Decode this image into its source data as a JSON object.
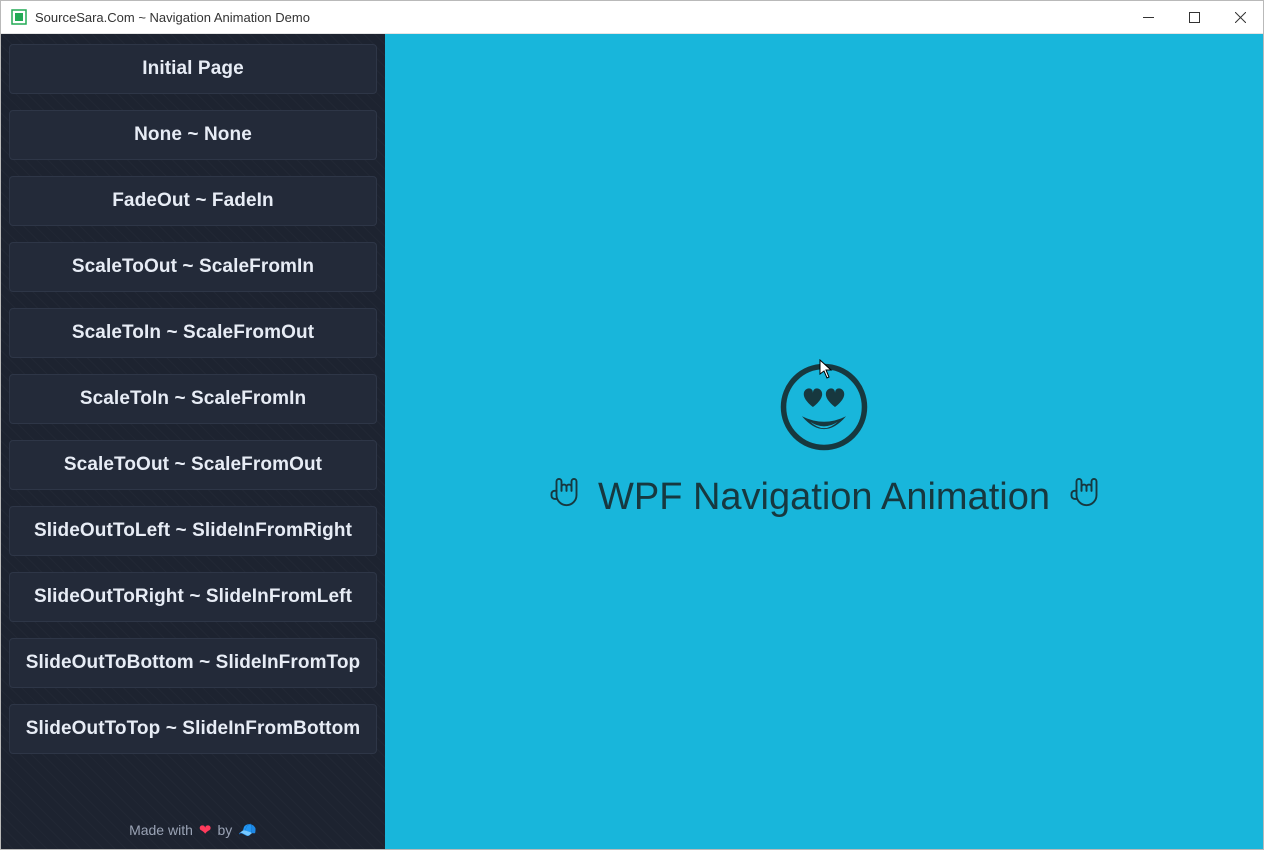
{
  "window": {
    "title": "SourceSara.Com ~ Navigation Animation Demo"
  },
  "sidebar": {
    "items": [
      {
        "label": "Initial Page"
      },
      {
        "label": "None ~ None"
      },
      {
        "label": "FadeOut ~ FadeIn"
      },
      {
        "label": "ScaleToOut ~ ScaleFromIn"
      },
      {
        "label": "ScaleToIn ~ ScaleFromOut"
      },
      {
        "label": "ScaleToIn ~ ScaleFromIn"
      },
      {
        "label": "ScaleToOut ~ ScaleFromOut"
      },
      {
        "label": "SlideOutToLeft ~ SlideInFromRight"
      },
      {
        "label": "SlideOutToRight ~ SlideInFromLeft"
      },
      {
        "label": "SlideOutToBottom ~ SlideInFromTop"
      },
      {
        "label": "SlideOutToTop ~ SlideInFromBottom"
      }
    ],
    "footer_prefix": "Made with",
    "footer_mid": "by"
  },
  "content": {
    "heading": "WPF Navigation Animation"
  },
  "colors": {
    "sidebar_bg": "#1d2330",
    "button_bg": "#232a39",
    "content_bg": "#18b6db",
    "content_fg": "#17383f"
  }
}
